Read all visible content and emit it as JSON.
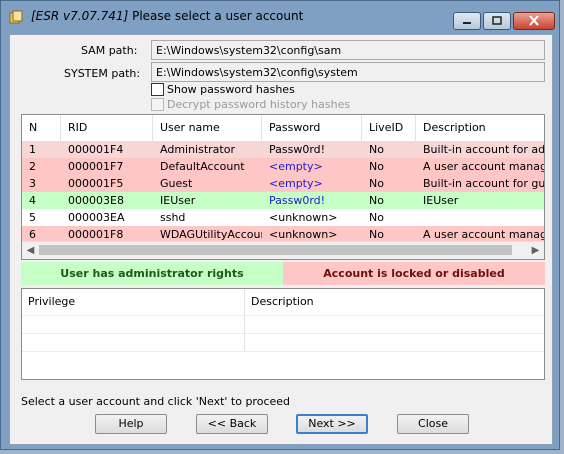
{
  "window": {
    "title_version": "[ESR v7.07.741]",
    "title_message": "Please select a user account"
  },
  "paths": {
    "sam_label": "SAM path:",
    "sam_value": "E:\\Windows\\system32\\config\\sam",
    "system_label": "SYSTEM path:",
    "system_value": "E:\\Windows\\system32\\config\\system"
  },
  "options": {
    "show_hashes": "Show password hashes",
    "decrypt_history": "Decrypt password history hashes"
  },
  "accounts": {
    "columns": [
      "N",
      "RID",
      "User name",
      "Password",
      "LiveID",
      "Description"
    ],
    "rows": [
      {
        "n": "1",
        "rid": "000001F4",
        "user": "Administrator",
        "password": "Passw0rd!",
        "liveid": "No",
        "description": "Built-in account for admir"
      },
      {
        "n": "2",
        "rid": "000001F7",
        "user": "DefaultAccount",
        "password": "<empty>",
        "liveid": "No",
        "description": "A user account managed"
      },
      {
        "n": "3",
        "rid": "000001F5",
        "user": "Guest",
        "password": "<empty>",
        "liveid": "No",
        "description": "Built-in account for guest"
      },
      {
        "n": "4",
        "rid": "000003E8",
        "user": "IEUser",
        "password": "Passw0rd!",
        "liveid": "No",
        "description": "IEUser"
      },
      {
        "n": "5",
        "rid": "000003EA",
        "user": "sshd",
        "password": "<unknown>",
        "liveid": "No",
        "description": ""
      },
      {
        "n": "6",
        "rid": "000001F8",
        "user": "WDAGUtilityAccount",
        "password": "<unknown>",
        "liveid": "No",
        "description": "A user account managed"
      }
    ]
  },
  "legend": {
    "admin": "User has administrator rights",
    "locked": "Account is locked or disabled"
  },
  "privileges": {
    "col_privilege": "Privilege",
    "col_description": "Description"
  },
  "status_text": "Select a user account and click 'Next' to proceed",
  "buttons": {
    "help": "Help",
    "back": "<< Back",
    "next": "Next >>",
    "close": "Close"
  },
  "colors": {
    "admin": "#c6ffc6",
    "locked": "#ffc6c6"
  }
}
